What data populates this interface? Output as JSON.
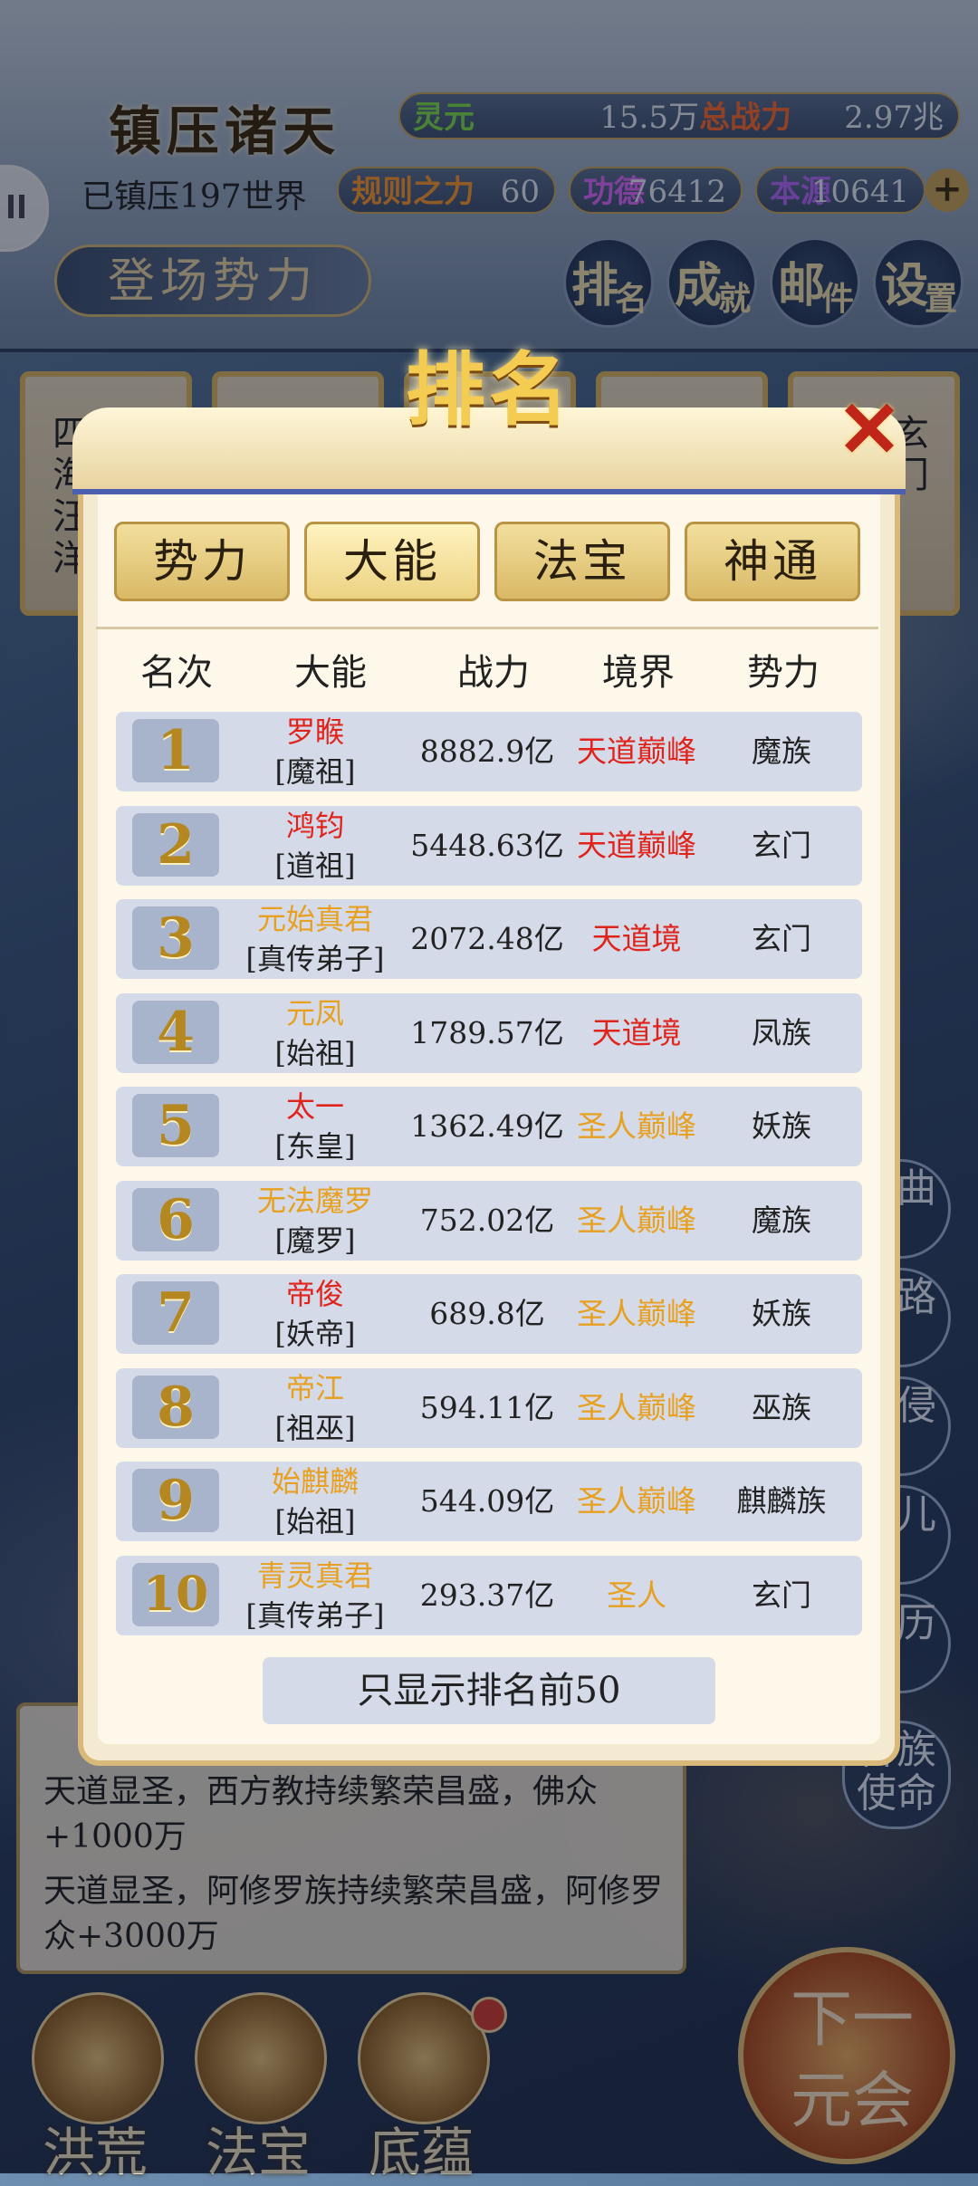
{
  "hud": {
    "title": "镇压诸天",
    "lingyuan_label": "灵元",
    "lingyuan_value": "15.5万",
    "total_power_label": "总战力",
    "total_power_value": "2.97兆",
    "suppressed": "已镇压197世界",
    "rule_label": "规则之力",
    "rule_value": "60",
    "merit_label": "功德",
    "merit_value": "76412",
    "origin_label": "本源",
    "origin_value": "10641",
    "plus": "+",
    "faction_button": "登场势力",
    "menu": [
      {
        "a": "排",
        "b": "名"
      },
      {
        "a": "成",
        "b": "就"
      },
      {
        "a": "邮",
        "b": "件"
      },
      {
        "a": "设",
        "b": "置"
      }
    ]
  },
  "background_cards": [
    "四海汪洋",
    "",
    "",
    "",
    "玄门"
  ],
  "modal": {
    "title": "排名",
    "close": "✕",
    "tabs": [
      "势力",
      "大能",
      "法宝",
      "神通"
    ],
    "active_tab": "大能",
    "headers": [
      "名次",
      "大能",
      "战力",
      "境界",
      "势力"
    ],
    "rows": [
      {
        "rank": "1",
        "name": "罗睺",
        "title": "[魔祖]",
        "power": "8882.9亿",
        "realm": "天道巅峰",
        "faction": "魔族",
        "name_color": "#e0241c",
        "realm_color": "#e0241c"
      },
      {
        "rank": "2",
        "name": "鸿钧",
        "title": "[道祖]",
        "power": "5448.63亿",
        "realm": "天道巅峰",
        "faction": "玄门",
        "name_color": "#e0241c",
        "realm_color": "#e0241c"
      },
      {
        "rank": "3",
        "name": "元始真君",
        "title": "[真传弟子]",
        "power": "2072.48亿",
        "realm": "天道境",
        "faction": "玄门",
        "name_color": "#e8a020",
        "realm_color": "#e0241c"
      },
      {
        "rank": "4",
        "name": "元凤",
        "title": "[始祖]",
        "power": "1789.57亿",
        "realm": "天道境",
        "faction": "凤族",
        "name_color": "#e8a020",
        "realm_color": "#e0241c"
      },
      {
        "rank": "5",
        "name": "太一",
        "title": "[东皇]",
        "power": "1362.49亿",
        "realm": "圣人巅峰",
        "faction": "妖族",
        "name_color": "#e0241c",
        "realm_color": "#e8a020"
      },
      {
        "rank": "6",
        "name": "无法魔罗",
        "title": "[魔罗]",
        "power": "752.02亿",
        "realm": "圣人巅峰",
        "faction": "魔族",
        "name_color": "#e8a020",
        "realm_color": "#e8a020"
      },
      {
        "rank": "7",
        "name": "帝俊",
        "title": "[妖帝]",
        "power": "689.8亿",
        "realm": "圣人巅峰",
        "faction": "妖族",
        "name_color": "#e0241c",
        "realm_color": "#e8a020"
      },
      {
        "rank": "8",
        "name": "帝江",
        "title": "[祖巫]",
        "power": "594.11亿",
        "realm": "圣人巅峰",
        "faction": "巫族",
        "name_color": "#e8a020",
        "realm_color": "#e8a020"
      },
      {
        "rank": "9",
        "name": "始麒麟",
        "title": "[始祖]",
        "power": "544.09亿",
        "realm": "圣人巅峰",
        "faction": "麒麟族",
        "name_color": "#e8a020",
        "realm_color": "#e8a020"
      },
      {
        "rank": "10",
        "name": "青灵真君",
        "title": "[真传弟子]",
        "power": "293.37亿",
        "realm": "圣人",
        "faction": "玄门",
        "name_color": "#e8a020",
        "realm_color": "#e8a020"
      }
    ],
    "footer": "只显示排名前50"
  },
  "news": [
    "天道显圣，西方教持续繁荣昌盛，佛众+1000万",
    "天道显圣，阿修罗族持续繁荣昌盛，阿修罗众+3000万"
  ],
  "right_side": [
    "暗曲",
    "道路",
    "域侵",
    "道儿",
    "身历",
    "各族使命"
  ],
  "bottom_nav": [
    "洪荒",
    "法宝",
    "底蕴"
  ],
  "next_button": "下一元会"
}
